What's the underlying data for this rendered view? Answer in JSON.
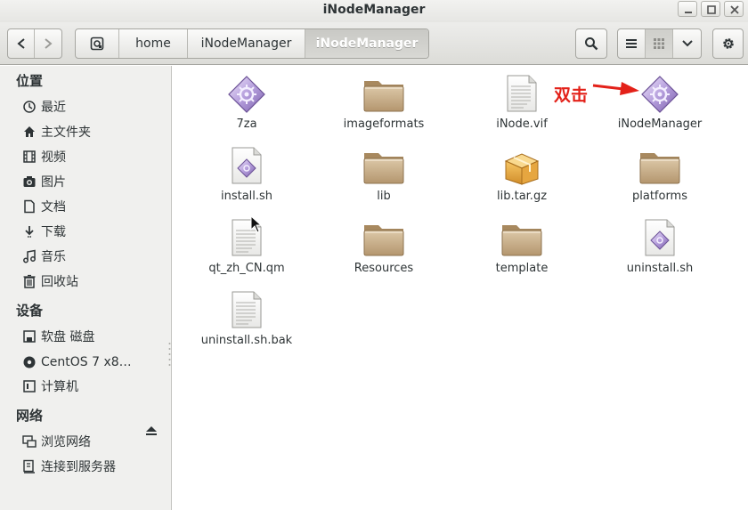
{
  "window": {
    "title": "iNodeManager"
  },
  "pathbar": {
    "segments": [
      "home",
      "iNodeManager",
      "iNodeManager"
    ]
  },
  "sidebar": {
    "sections": [
      {
        "title": "位置",
        "items": [
          {
            "label": "最近",
            "icon": "clock-icon"
          },
          {
            "label": "主文件夹",
            "icon": "home-icon"
          },
          {
            "label": "视频",
            "icon": "film-icon"
          },
          {
            "label": "图片",
            "icon": "camera-icon"
          },
          {
            "label": "文档",
            "icon": "document-icon"
          },
          {
            "label": "下载",
            "icon": "download-icon"
          },
          {
            "label": "音乐",
            "icon": "music-icon"
          },
          {
            "label": "回收站",
            "icon": "trash-icon"
          }
        ]
      },
      {
        "title": "设备",
        "items": [
          {
            "label": "软盘 磁盘",
            "icon": "floppy-icon"
          },
          {
            "label": "CentOS 7 x8…",
            "icon": "disc-icon"
          },
          {
            "label": "计算机",
            "icon": "computer-icon"
          }
        ]
      },
      {
        "title": "网络",
        "items": [
          {
            "label": "浏览网络",
            "icon": "network-icon"
          },
          {
            "label": "连接到服务器",
            "icon": "server-icon"
          }
        ]
      }
    ]
  },
  "files": [
    {
      "name": "7za",
      "type": "executable"
    },
    {
      "name": "imageformats",
      "type": "folder"
    },
    {
      "name": "iNode.vif",
      "type": "text"
    },
    {
      "name": "iNodeManager",
      "type": "executable"
    },
    {
      "name": "install.sh",
      "type": "script"
    },
    {
      "name": "lib",
      "type": "folder"
    },
    {
      "name": "lib.tar.gz",
      "type": "archive"
    },
    {
      "name": "platforms",
      "type": "folder"
    },
    {
      "name": "qt_zh_CN.qm",
      "type": "text"
    },
    {
      "name": "Resources",
      "type": "folder"
    },
    {
      "name": "template",
      "type": "folder"
    },
    {
      "name": "uninstall.sh",
      "type": "script"
    },
    {
      "name": "uninstall.sh.bak",
      "type": "text"
    }
  ],
  "annotation": {
    "text": "双击",
    "color": "#e32119"
  },
  "colors": {
    "folder": "#c4a783",
    "exec": "#9b84c4",
    "accent": "#e32119"
  }
}
